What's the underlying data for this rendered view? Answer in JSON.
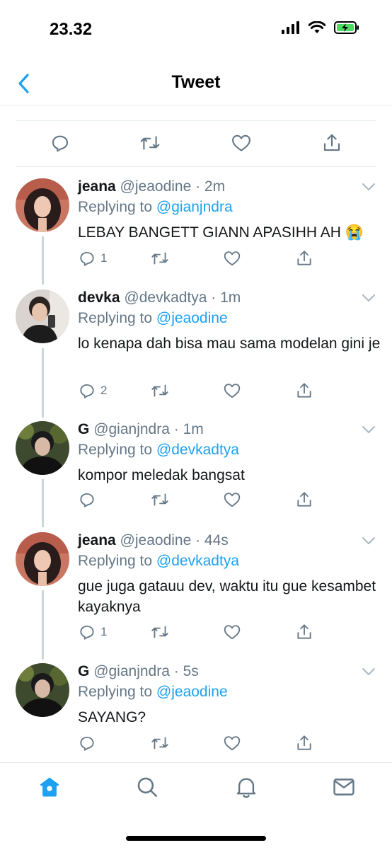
{
  "status_bar": {
    "time": "23.32"
  },
  "nav": {
    "title": "Tweet"
  },
  "colors": {
    "accent": "#1da1f2",
    "muted": "#657786",
    "battery": "#4cd964"
  },
  "tweets": [
    {
      "name": "jeana",
      "handle": "@jeaodine · 2m",
      "replying_label": "Replying to",
      "replying_to": "@gianjndra",
      "text": "LEBAY BANGETT GIANN APASIHH AH 😭",
      "reply_count": "1",
      "avatar": "avatar-jeana"
    },
    {
      "name": "devka",
      "handle": "@devkadtya · 1m",
      "replying_label": "Replying to",
      "replying_to": "@jeaodine",
      "text": "lo kenapa dah bisa mau sama modelan gini je",
      "reply_count": "2",
      "avatar": "avatar-devka"
    },
    {
      "name": "G",
      "handle": "@gianjndra · 1m",
      "replying_label": "Replying to",
      "replying_to": "@devkadtya",
      "text": "kompor meledak bangsat",
      "reply_count": "",
      "avatar": "avatar-g"
    },
    {
      "name": "jeana",
      "handle": "@jeaodine · 44s",
      "replying_label": "Replying to",
      "replying_to": "@devkadtya",
      "text": "gue juga gatauu dev, waktu itu gue kesambet kayaknya",
      "reply_count": "1",
      "avatar": "avatar-jeana"
    },
    {
      "name": "G",
      "handle": "@gianjndra · 5s",
      "replying_label": "Replying to",
      "replying_to": "@jeaodine",
      "text": "SAYANG?",
      "reply_count": "",
      "avatar": "avatar-g"
    }
  ],
  "tab_bar": {
    "items": [
      "home-icon",
      "search-icon",
      "notifications-icon",
      "messages-icon"
    ],
    "active": "home-icon"
  }
}
